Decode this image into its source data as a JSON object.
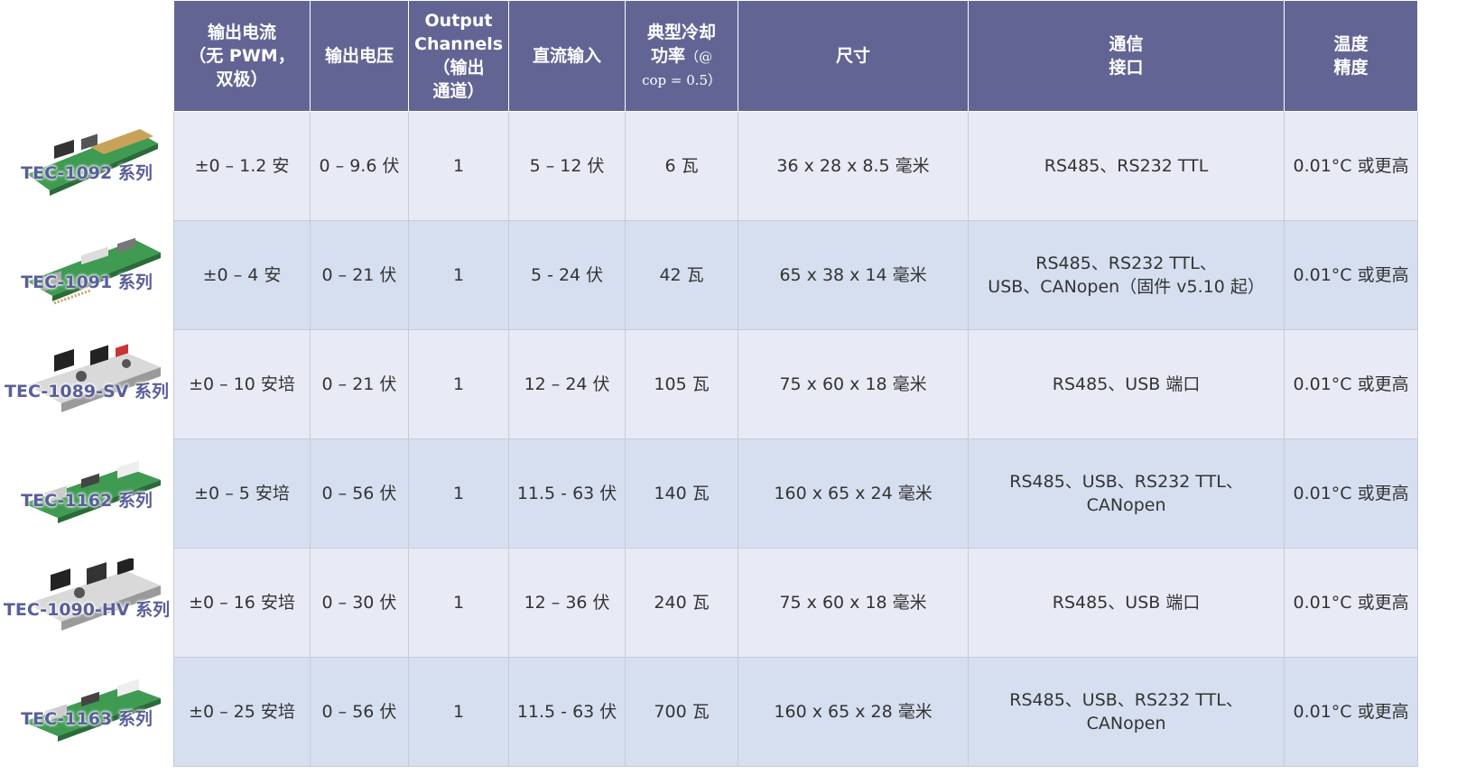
{
  "headers": {
    "current": [
      "输出电流",
      "（无 PWM，",
      "双极）"
    ],
    "voltage": "输出电压",
    "channels": [
      "Output",
      "Channels",
      "（输出",
      "通道）"
    ],
    "dc_input": "直流输入",
    "cooling": [
      "典型冷却",
      "功率",
      "（@",
      "cop = 0.5）"
    ],
    "size": "尺寸",
    "comm": [
      "通信",
      "接口"
    ],
    "temp": [
      "温度",
      "精度"
    ]
  },
  "rows": [
    {
      "series": "TEC-1092 系列",
      "current": "±0 – 1.2 安",
      "voltage": "0 – 9.6 伏",
      "channels": "1",
      "dc_input": "5 – 12 伏",
      "power": "6 瓦",
      "size": "36 x 28 x 8.5 毫米",
      "comm": [
        "RS485、RS232 TTL"
      ],
      "temp": "0.01°C 或更高"
    },
    {
      "series": "TEC-1091 系列",
      "current": "±0 – 4 安",
      "voltage": "0 – 21 伏",
      "channels": "1",
      "dc_input": "5 - 24 伏",
      "power": "42 瓦",
      "size": "65 x 38 x 14 毫米",
      "comm": [
        "RS485、RS232 TTL、",
        "USB、CANopen（固件 v5.10 起）"
      ],
      "temp": "0.01°C 或更高"
    },
    {
      "series": "TEC-1089-SV 系列",
      "current": "±0 – 10 安培",
      "voltage": "0 – 21 伏",
      "channels": "1",
      "dc_input": "12 – 24 伏",
      "power": "105 瓦",
      "size": "75 x 60 x 18 毫米",
      "comm": [
        "RS485、USB 端口"
      ],
      "temp": "0.01°C 或更高"
    },
    {
      "series": "TEC-1162 系列",
      "current": "±0 – 5 安培",
      "voltage": "0 – 56 伏",
      "channels": "1",
      "dc_input": "11.5 - 63 伏",
      "power": "140 瓦",
      "size": "160 x 65 x 24 毫米",
      "comm": [
        "RS485、USB、RS232 TTL、",
        "CANopen"
      ],
      "temp": "0.01°C 或更高"
    },
    {
      "series": "TEC-1090-HV 系列",
      "current": "±0 – 16 安培",
      "voltage": "0 – 30 伏",
      "channels": "1",
      "dc_input": "12 – 36 伏",
      "power": "240 瓦",
      "size": "75 x 60 x 18 毫米",
      "comm": [
        "RS485、USB 端口"
      ],
      "temp": "0.01°C 或更高"
    },
    {
      "series": "TEC-1163 系列",
      "current": "±0 – 25 安培",
      "voltage": "0 – 56 伏",
      "channels": "1",
      "dc_input": "11.5 - 63 伏",
      "power": "700 瓦",
      "size": "160 x 65 x 28 毫米",
      "comm": [
        "RS485、USB、RS232 TTL、",
        "CANopen"
      ],
      "temp": "0.01°C 或更高"
    }
  ],
  "colors": {
    "header_bg": "#626594",
    "row_odd": "#e8ebf6",
    "row_even": "#d6dff0",
    "power_text": "#6e73a8",
    "series_label": "#5a5f9a",
    "board_green": "#3f9a52"
  }
}
